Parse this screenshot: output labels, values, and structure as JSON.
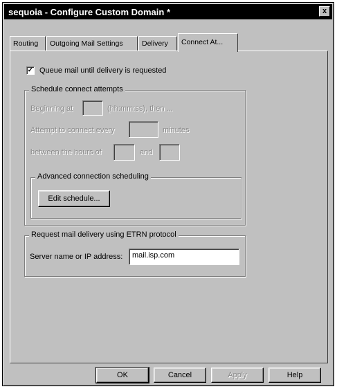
{
  "window": {
    "title": "sequoia - Configure Custom Domain *",
    "close_glyph": "x"
  },
  "tabs": [
    {
      "label": "Routing"
    },
    {
      "label": "Outgoing Mail Settings"
    },
    {
      "label": "Delivery"
    },
    {
      "label": "Connect At..."
    }
  ],
  "queue": {
    "checked_glyph": "✓",
    "label": "Queue mail until delivery is requested"
  },
  "schedule": {
    "legend": "Schedule connect attempts",
    "beginning_label": "Beginning at",
    "beginning_suffix": "(hh:mm:ss), then ...",
    "attempt_label": "Attempt to connect every",
    "attempt_suffix": "minutes",
    "between_label": "between the hours of",
    "between_and": "and",
    "advanced_legend": "Advanced connection scheduling",
    "edit_button": "Edit schedule..."
  },
  "etrn": {
    "legend": "Request mail delivery using ETRN protocol",
    "server_label": "Server name or IP address:",
    "server_value": "mail.isp.com"
  },
  "buttons": {
    "ok": "OK",
    "cancel": "Cancel",
    "apply": "Apply",
    "help": "Help"
  }
}
